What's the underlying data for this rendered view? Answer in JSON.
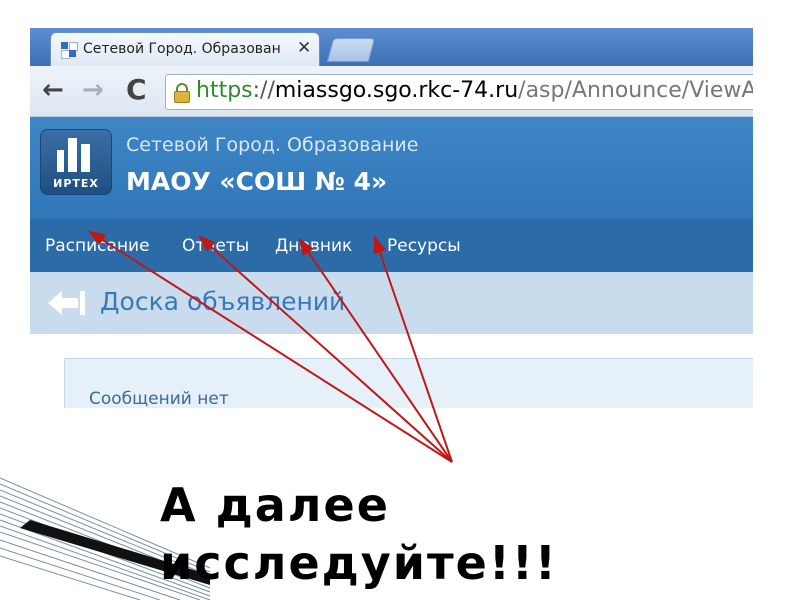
{
  "browser": {
    "tab_title": "Сетевой Город. Образован",
    "tab_close": "✕",
    "url_scheme": "https",
    "url_sep": "://",
    "url_host": "miassgo.sgo.rkc-74.ru",
    "url_path": "/asp/Announce/ViewAnn",
    "back_glyph": "←",
    "forward_glyph": "→",
    "reload_glyph": "C"
  },
  "site": {
    "logo_text": "ИРТЕХ",
    "subtitle": "Сетевой Город. Образование",
    "title": "МАОУ «СОШ № 4»",
    "nav": [
      "Расписание",
      "Отчеты",
      "Дневник",
      "Ресурсы"
    ]
  },
  "page": {
    "title": "Доска объявлений",
    "empty_message": "Сообщений нет"
  },
  "overlay": {
    "caption_line1": "А далее",
    "caption_line2": "исследуйте!!!",
    "arrow_color": "#c01818"
  }
}
